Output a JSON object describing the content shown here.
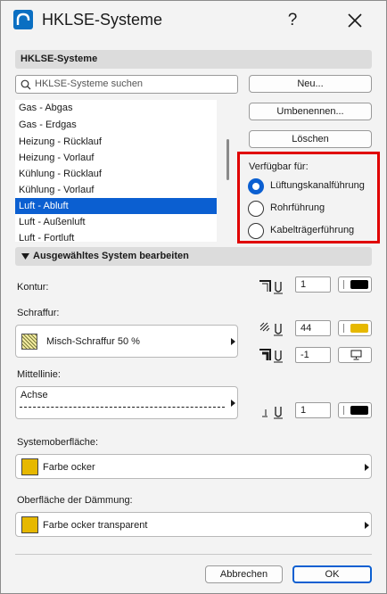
{
  "window": {
    "title": "HKLSE-Systeme",
    "help": "?",
    "colors": {
      "accent": "#0b5fd1",
      "highlight_border": "#e00000",
      "ochre": "#e6b800"
    }
  },
  "systems_section": {
    "header": "HKLSE-Systeme",
    "search_placeholder": "HKLSE-Systeme suchen",
    "buttons": {
      "new": "Neu...",
      "rename": "Umbenennen...",
      "delete": "Löschen"
    },
    "items": [
      "Gas - Abgas",
      "Gas - Erdgas",
      "Heizung - Rücklauf",
      "Heizung - Vorlauf",
      "Kühlung - Rücklauf",
      "Kühlung - Vorlauf",
      "Luft - Abluft",
      "Luft - Außenluft",
      "Luft - Fortluft"
    ],
    "selected_item": "Luft - Abluft"
  },
  "available_for": {
    "label": "Verfügbar für:",
    "options": [
      "Lüftungskanalführung",
      "Rohrführung",
      "Kabelträgerführung"
    ],
    "selected": "Lüftungskanalführung"
  },
  "edit_section": {
    "header": "Ausgewähltes System bearbeiten",
    "contour": {
      "label": "Kontur:",
      "pen": "1"
    },
    "hatch": {
      "label": "Schraffur:",
      "value": "Misch-Schraffur 50 %",
      "fg_pen": "44",
      "bg_pen": "-1"
    },
    "centerline": {
      "label": "Mittellinie:",
      "value": "Achse",
      "pen": "1"
    },
    "system_surface": {
      "label": "Systemoberfläche:",
      "value": "Farbe ocker"
    },
    "insulation_surface": {
      "label": "Oberfläche der Dämmung:",
      "value": "Farbe ocker  transparent"
    }
  },
  "footer": {
    "cancel": "Abbrechen",
    "ok": "OK"
  }
}
